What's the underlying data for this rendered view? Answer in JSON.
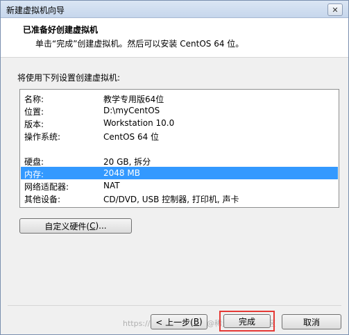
{
  "window": {
    "title": "新建虚拟机向导",
    "close_icon": "close-icon"
  },
  "header": {
    "title": "已准备好创建虚拟机",
    "subtitle": "单击“完成”创建虚拟机。然后可以安装 CentOS 64 位。"
  },
  "section_label": "将使用下列设置创建虚拟机:",
  "summary": {
    "rows": [
      {
        "key": "名称:",
        "value": "教学专用版64位"
      },
      {
        "key": "位置:",
        "value": "D:\\myCentOS"
      },
      {
        "key": "版本:",
        "value": "Workstation 10.0"
      },
      {
        "key": "操作系统:",
        "value": "CentOS 64 位"
      },
      {
        "key": "硬盘:",
        "value": "20 GB, 拆分"
      },
      {
        "key": "内存:",
        "value": "2048 MB"
      },
      {
        "key": "网络适配器:",
        "value": "NAT"
      },
      {
        "key": "其他设备:",
        "value": "CD/DVD, USB 控制器, 打印机, 声卡"
      }
    ],
    "selected_row": 5
  },
  "buttons": {
    "customize_hw": {
      "label": "自定义硬件(",
      "accel": "C",
      "suffix": ")..."
    },
    "back": {
      "label": "< 上一步(",
      "accel": "B",
      "suffix": ")"
    },
    "finish": "完成",
    "cancel": "取消"
  },
  "colors": {
    "selection": "#3399ff",
    "highlight_border": "#e53935"
  },
  "watermark": "https://blog.csdn.net/   @稀土掘金技术社区"
}
